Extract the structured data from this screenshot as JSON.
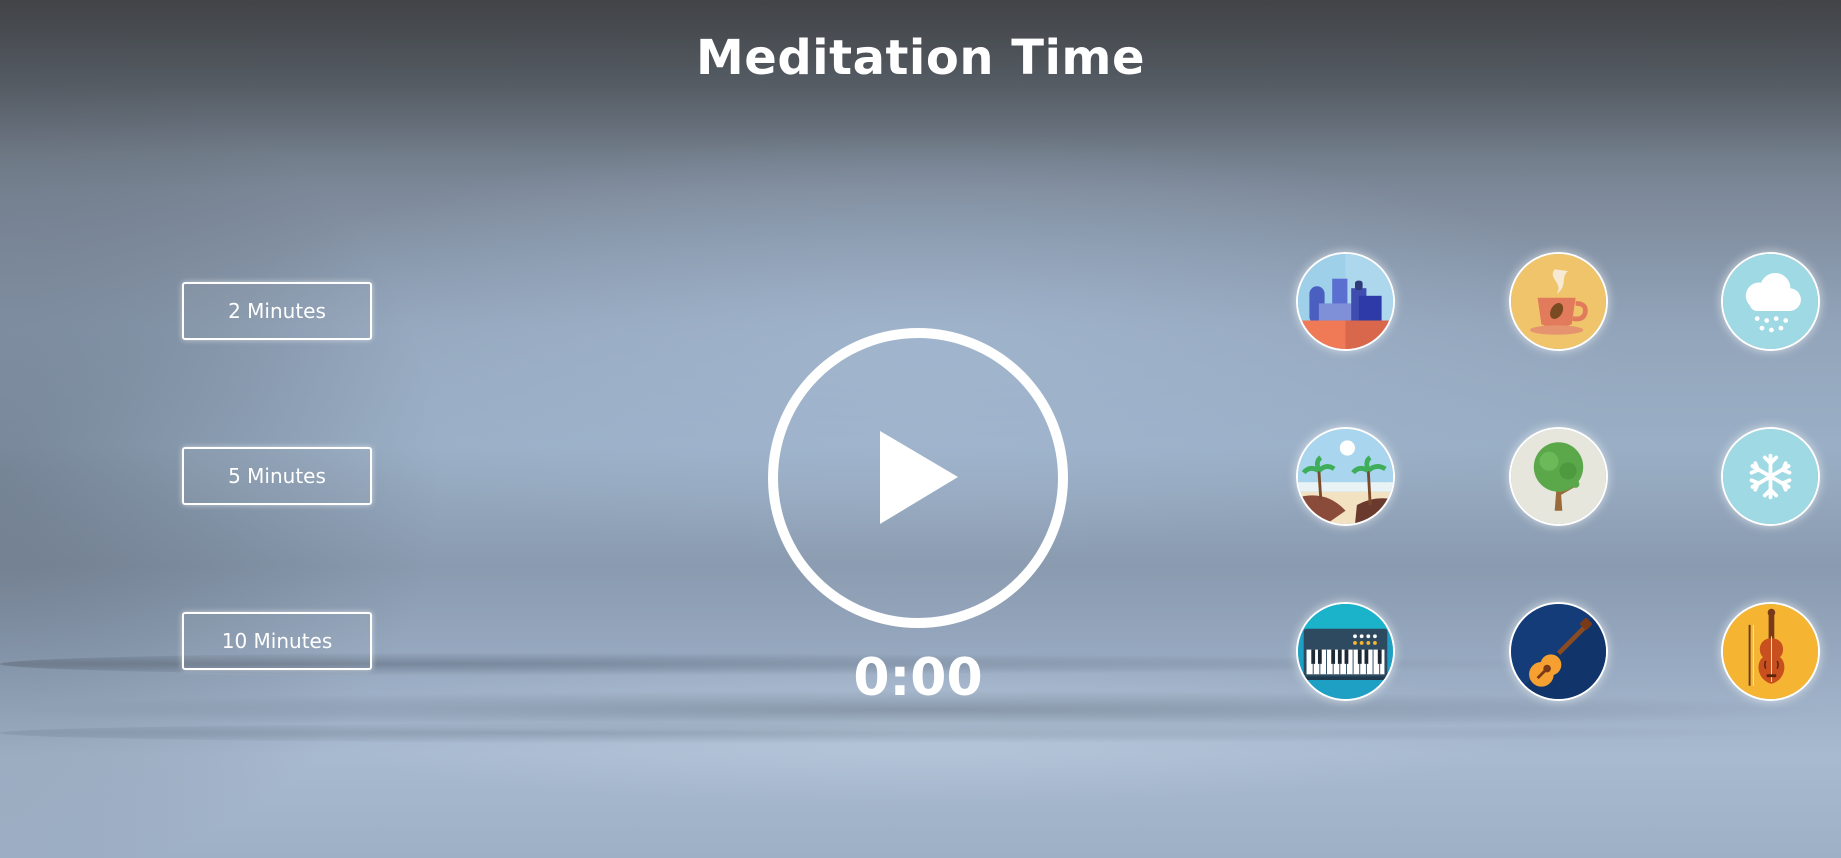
{
  "app": {
    "title": "Meditation Time"
  },
  "durations": [
    {
      "label": "2 Minutes"
    },
    {
      "label": "5 Minutes"
    },
    {
      "label": "10 Minutes"
    }
  ],
  "player": {
    "state_icon": "play-icon",
    "time_display": "0:00"
  },
  "sounds": [
    {
      "icon": "city-icon",
      "color": "#9fd0ea"
    },
    {
      "icon": "coffee-cup-icon",
      "color": "#f0c46a"
    },
    {
      "icon": "rain-cloud-icon",
      "color": "#9fd9e4"
    },
    {
      "icon": "beach-icon",
      "color": "#a9d6ee"
    },
    {
      "icon": "tree-icon",
      "color": "#e6e6dc"
    },
    {
      "icon": "snowflake-icon",
      "color": "#9fd9e4"
    },
    {
      "icon": "piano-icon",
      "color": "#1e9fc4"
    },
    {
      "icon": "guitar-icon",
      "color": "#143c78"
    },
    {
      "icon": "violin-icon",
      "color": "#f5b533"
    }
  ],
  "colors": {
    "text": "#ffffff",
    "button_border": "#ffffff"
  }
}
